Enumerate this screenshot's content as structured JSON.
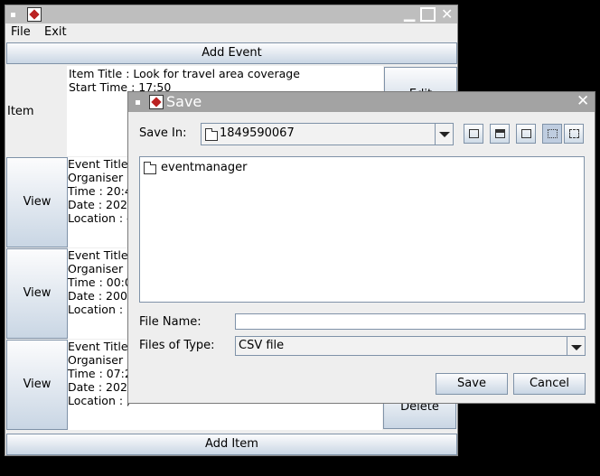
{
  "main": {
    "menu": [
      "File",
      "Exit"
    ],
    "add_event": "Add Event",
    "add_item": "Add Item",
    "item_label": "Item",
    "item_title": "Item Title : Look for travel area coverage",
    "item_start": "Start Time : 17:50",
    "edit": "Edit",
    "delete": "Delete",
    "view": "View",
    "events": [
      {
        "title": "Event Title",
        "organiser": "Organiser :",
        "time": "Time : 20:4",
        "date": "Date : 202",
        "location": "Location : -"
      },
      {
        "title": "Event Title",
        "organiser": "Organiser :",
        "time": "Time : 00:0",
        "date": "Date : 200",
        "location": "Location : I"
      },
      {
        "title": "Event Title",
        "organiser": "Organiser :",
        "time": "Time : 07:2",
        "date": "Date : 202",
        "location": "Location : ,"
      }
    ]
  },
  "dialog": {
    "title": "Save",
    "save_in_label": "Save In:",
    "save_in_value": "1849590067",
    "files": [
      "eventmanager"
    ],
    "file_name_label": "File Name:",
    "file_name_value": "",
    "file_type_label": "Files of Type:",
    "file_type_value": "CSV file",
    "save": "Save",
    "cancel": "Cancel"
  }
}
